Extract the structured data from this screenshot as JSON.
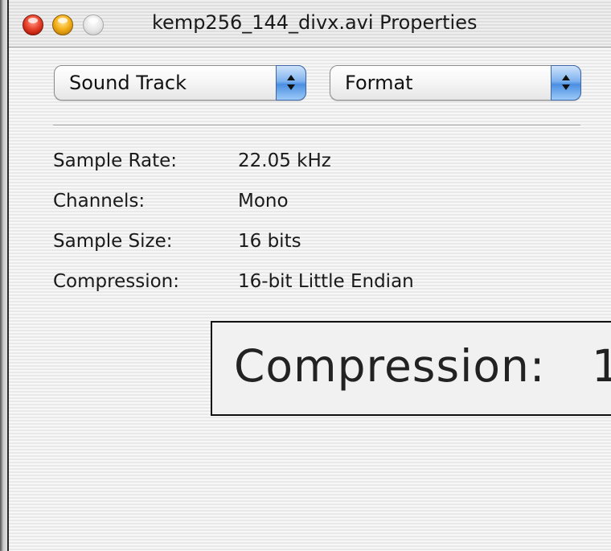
{
  "window": {
    "title": "kemp256_144_divx.avi Properties"
  },
  "popups": {
    "track": {
      "selected": "Sound Track"
    },
    "category": {
      "selected": "Format"
    }
  },
  "properties": [
    {
      "label": "Sample Rate:",
      "value": "22.05  kHz"
    },
    {
      "label": "Channels:",
      "value": "Mono"
    },
    {
      "label": "Sample Size:",
      "value": "16 bits"
    },
    {
      "label": "Compression:",
      "value": "16-bit Little Endian"
    }
  ],
  "zoom_callout": {
    "label": "Compression:",
    "value_visible": "1"
  },
  "colors": {
    "close": "#e8442c",
    "minimize": "#f6b21b",
    "zoom": "#e6e6e6",
    "popup_accent": "#4b8fe2"
  }
}
